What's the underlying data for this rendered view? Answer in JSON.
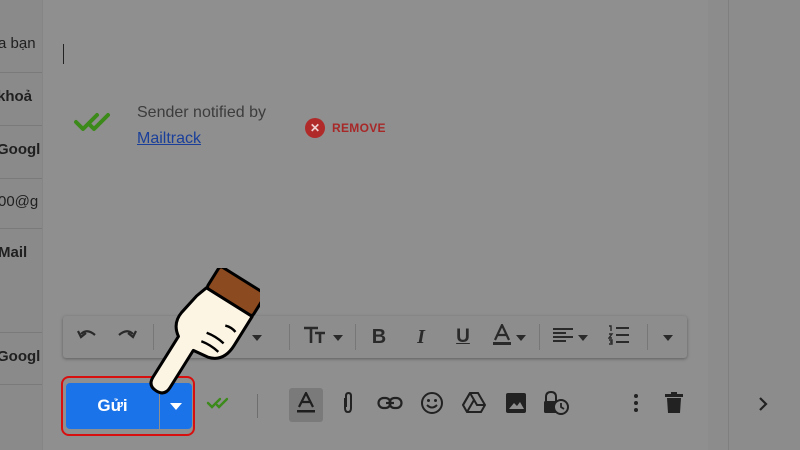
{
  "left_list": {
    "items": [
      "a bạn",
      "khoả",
      "Googl",
      "00@g",
      "Mail",
      "Googl"
    ]
  },
  "mailtrack": {
    "notice": "Sender notified by",
    "link": "Mailtrack",
    "remove_label": "REMOVE"
  },
  "format_toolbar": {
    "font_label": "rif"
  },
  "compose_footer": {
    "send_label": "Gửi"
  },
  "colors": {
    "send_button": "#1a73e8",
    "highlight_outline": "#d80f0f",
    "remove_red": "#a82828",
    "check_green": "#3c8a1a"
  }
}
